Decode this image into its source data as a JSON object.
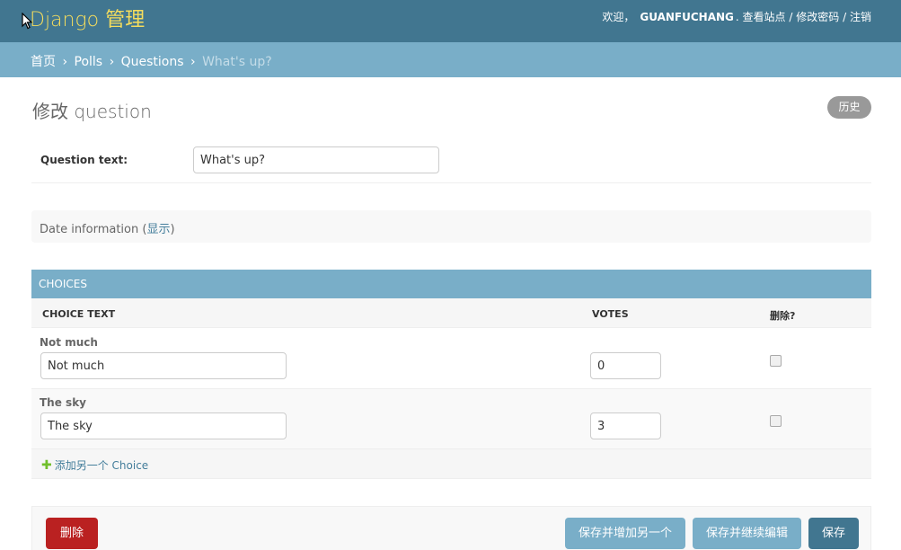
{
  "header": {
    "brand": "Django 管理",
    "welcome": "欢迎，",
    "username": "GUANFUCHANG",
    "view_site": "查看站点",
    "change_password": "修改密码",
    "logout": "注销",
    "sep": "/"
  },
  "breadcrumbs": {
    "home": "首页",
    "app": "Polls",
    "model": "Questions",
    "current": "What's up?",
    "sep": "›"
  },
  "page": {
    "title": "修改 question",
    "history": "历史"
  },
  "form": {
    "question_label": "Question text:",
    "question_value": "What's up?",
    "date_fieldset": "Date information",
    "date_toggle_open": "(",
    "date_toggle": "显示",
    "date_toggle_close": ")"
  },
  "choices": {
    "heading": "CHOICES",
    "col_choice_text": "CHOICE TEXT",
    "col_votes": "VOTES",
    "col_delete": "删除?",
    "rows": [
      {
        "original": "Not much",
        "choice_text": "Not much",
        "votes": "0",
        "delete": false
      },
      {
        "original": "The sky",
        "choice_text": "The sky",
        "votes": "3",
        "delete": false
      }
    ],
    "add_another": "添加另一个 Choice"
  },
  "actions": {
    "delete": "删除",
    "save_add_another": "保存并增加另一个",
    "save_continue": "保存并继续编辑",
    "save": "保存"
  },
  "colors": {
    "header_bg": "#417690",
    "brand_color": "#f5dd5d",
    "breadcrumb_bg": "#79aec8",
    "delete_btn": "#ba2121",
    "save_btn": "#417690",
    "secondary_btn": "#79aec8"
  },
  "icons": {
    "add": "plus-icon",
    "cursor": "mouse-cursor-icon"
  }
}
